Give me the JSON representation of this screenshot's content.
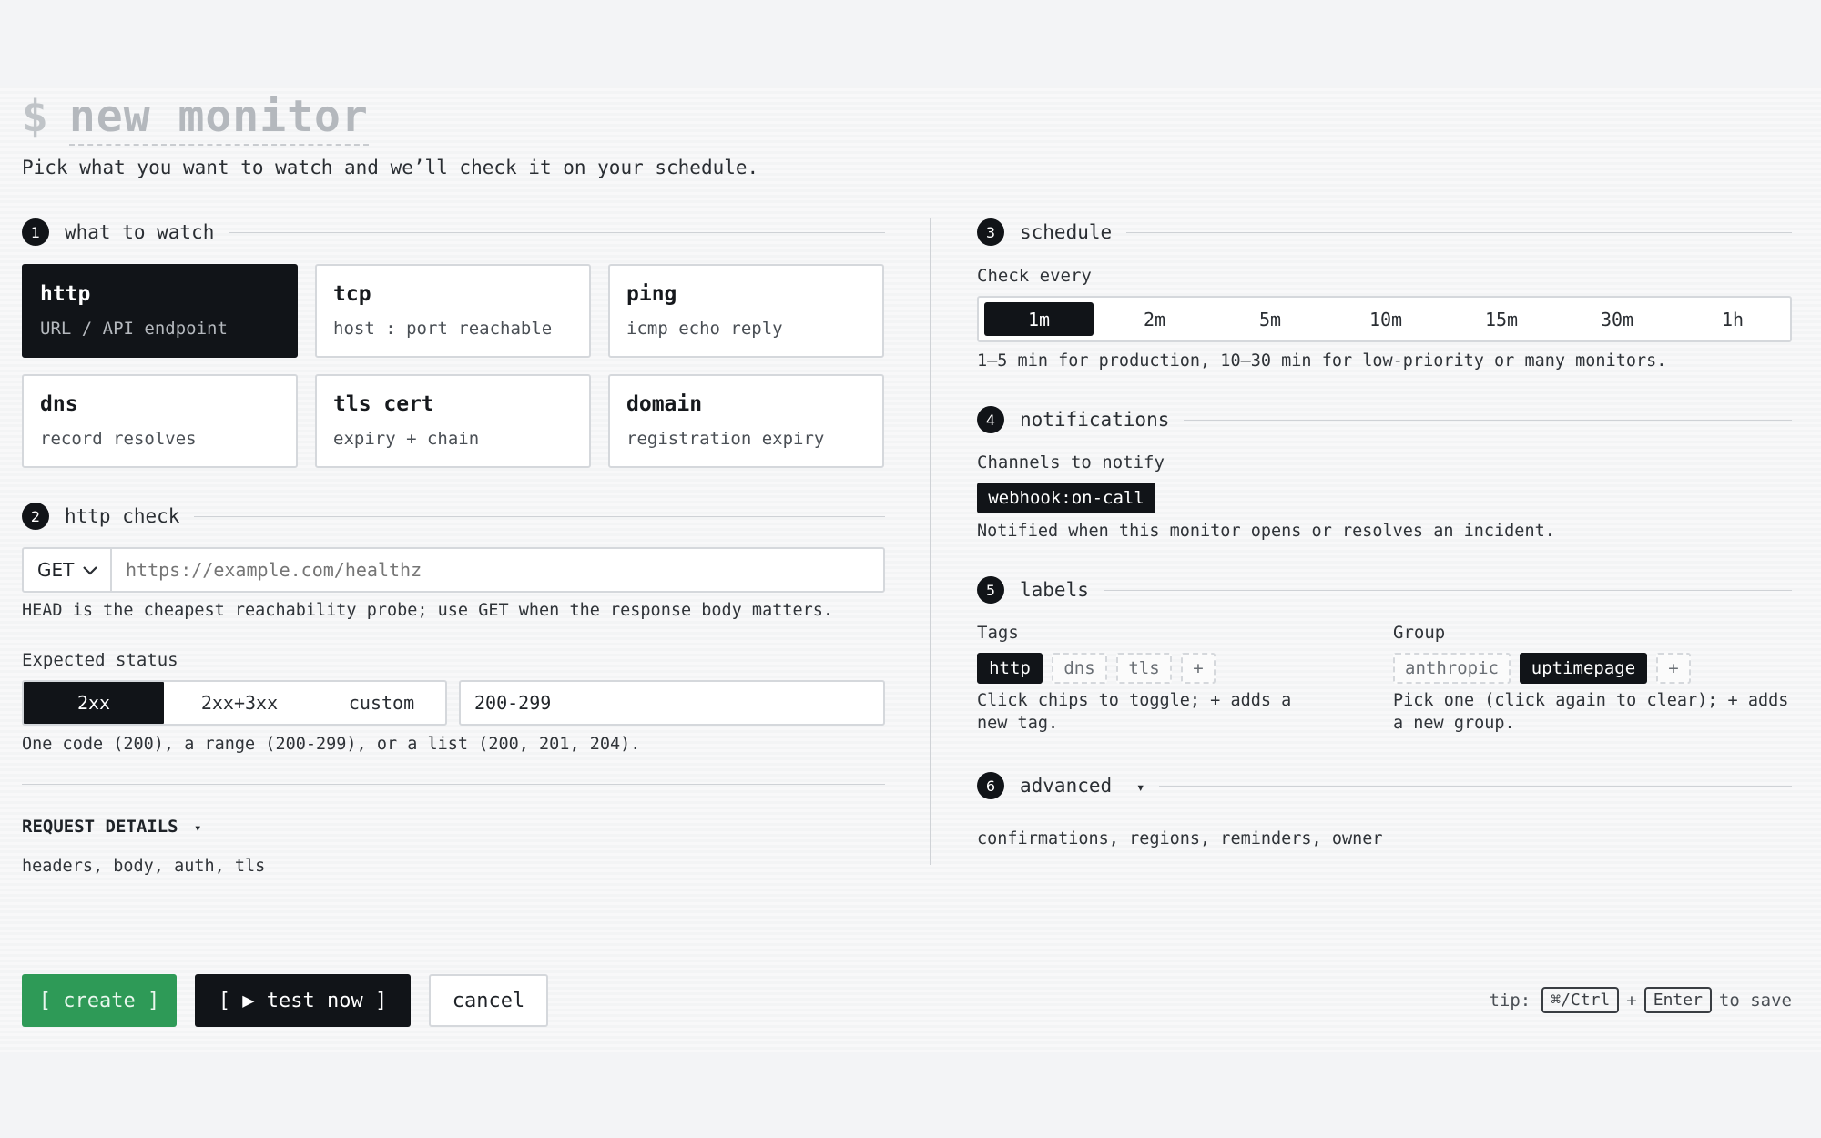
{
  "header": {
    "prompt": "$",
    "title": "new monitor",
    "subtitle": "Pick what you want to watch and we’ll check it on your schedule."
  },
  "sections": {
    "s1": {
      "num": "1",
      "label": "what to watch"
    },
    "s2": {
      "num": "2",
      "label": "http check"
    },
    "s3": {
      "num": "3",
      "label": "schedule"
    },
    "s4": {
      "num": "4",
      "label": "notifications"
    },
    "s5": {
      "num": "5",
      "label": "labels"
    },
    "s6": {
      "num": "6",
      "label": "advanced",
      "caret": "▾"
    }
  },
  "types": [
    {
      "title": "http",
      "sub": "URL / API endpoint",
      "selected": true
    },
    {
      "title": "tcp",
      "sub": "host : port reachable"
    },
    {
      "title": "ping",
      "sub": "icmp echo reply"
    },
    {
      "title": "dns",
      "sub": "record resolves"
    },
    {
      "title": "tls cert",
      "sub": "expiry + chain"
    },
    {
      "title": "domain",
      "sub": "registration expiry"
    }
  ],
  "http": {
    "method": "GET",
    "url_placeholder": "https://example.com/healthz",
    "method_hint": "HEAD is the cheapest reachability probe; use GET when the response body matters.",
    "expected_label": "Expected status",
    "status_options": [
      "2xx",
      "2xx+3xx",
      "custom"
    ],
    "status_selected": "2xx",
    "status_value": "200-299",
    "status_hint": "One code (200), a range (200-299), or a list (200, 201, 204).",
    "request_details": "REQUEST DETAILS",
    "request_caret": "▾",
    "request_sub": "headers, body, auth, tls"
  },
  "schedule": {
    "label": "Check every",
    "options": [
      "1m",
      "2m",
      "5m",
      "10m",
      "15m",
      "30m",
      "1h"
    ],
    "selected": "1m",
    "hint": "1–5 min for production, 10–30 min for low-priority or many monitors."
  },
  "notifications": {
    "label": "Channels to notify",
    "channel": "webhook:on-call",
    "hint": "Notified when this monitor opens or resolves an incident."
  },
  "labels": {
    "tags_label": "Tags",
    "tags": [
      {
        "name": "http",
        "on": true
      },
      {
        "name": "dns",
        "on": false
      },
      {
        "name": "tls",
        "on": false
      },
      {
        "name": "+",
        "on": false
      }
    ],
    "tags_hint_1": "Click chips to toggle; + adds a",
    "tags_hint_2": "new tag.",
    "group_label": "Group",
    "groups": [
      {
        "name": "anthropic",
        "on": false
      },
      {
        "name": "uptimepage",
        "on": true
      },
      {
        "name": "+",
        "on": false
      }
    ],
    "group_hint_1": "Pick one (click again to clear); + adds",
    "group_hint_2": "a new group."
  },
  "advanced": {
    "sub": "confirmations, regions, reminders, owner"
  },
  "footer": {
    "create": "[ create ]",
    "test_now": "[ ▶ test now ]",
    "cancel": "cancel",
    "tip": "tip:",
    "key1": "⌘/Ctrl",
    "plus": "+",
    "key2": "Enter",
    "to_save": "to save"
  },
  "colors": {
    "accent_green": "#2e9a57",
    "dark": "#111418"
  }
}
